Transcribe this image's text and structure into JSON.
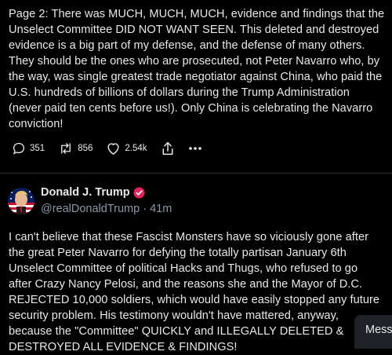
{
  "post1": {
    "text": "Page 2: There was MUCH, MUCH, MUCH, evidence and findings that the\nUnselect Committee DID NOT WANT SEEN. This deleted and destroyed\nevidence is a big part of my defense, and the defense of many others.\nThey should be the ones who are prosecuted, not Peter Navarro who, by\nthe way, was single greatest trade negotiator against China, who paid the\nU.S. hundreds of billions of dollars during the Trump Administration\n(never paid ten cents before us!). Only China is celebrating the Navarro\nconviction!",
    "replies": "351",
    "reposts": "856",
    "likes": "2.54k"
  },
  "post2": {
    "display_name": "Donald J. Trump",
    "handle": "@realDonaldTrump",
    "separator": "·",
    "time": "41m",
    "text": "I can't believe that these Fascist Monsters have so viciously gone after\nthe great Peter Navarro for defying the totally partisan January 6th\nUnselect Committee of political Hacks and Thugs, who refused to go\nafter Crazy Nancy Pelosi, and the reasons she and the Mayor of D.C.\nREJECTED 10,000 soldiers, which would have easily stopped any future\nsecurity problem. His testimony wouldn't have mattered, anyway,\nbecause the \"Committee\" QUICKLY and ILLEGALLY DELETED &\nDESTROYED ALL EVIDENCE & FINDINGS!"
  },
  "messages_button": {
    "label": "Mess"
  },
  "colors": {
    "background": "#000000",
    "text": "#e7e9ea",
    "muted": "#8b98a5",
    "verified_badge": "#e0245e",
    "divider": "#2f3336"
  },
  "icons": [
    "reply-icon",
    "repost-icon",
    "like-icon",
    "share-icon",
    "more-icon",
    "verified-badge-icon"
  ]
}
